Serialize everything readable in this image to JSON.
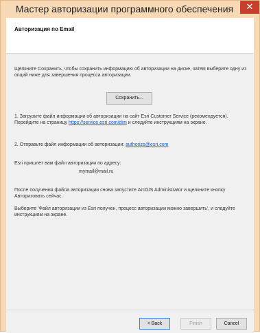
{
  "window": {
    "title": "Мастер авторизации программного обеспечения",
    "close_glyph": "✕"
  },
  "header": {
    "title": "Авторизация по Email"
  },
  "content": {
    "intro": "Щелкните Сохранить, чтобы сохранить информацию об авторизации на диске, затем выберите одну из опций ниже для завершения процесса авторизации.",
    "save_button": "Сохранить...",
    "step1_before": "1.  Загрузите файл информации об авторизации на сайт Esri Customer Service (рекомендуется). Перейдите  на страницу ",
    "step1_link": "https://service.esri.com/dim",
    "step1_after": " и следуйте инструкциям на экране.",
    "step2_before": "2.  Отправьте файл информации об авторизации: ",
    "step2_link": "authorize@esri.com",
    "esri_sends": "Esri пришлет вам файл авторизации по адресу:",
    "email": "mymail@mail.ru",
    "after_receive": "После получения файла авторизации снова запустите ArcGIS Administrator и щелкните кнопку Авторизовать сейчас.",
    "select_option": "Выберите 'Файл авторизации из Esri получен, процесс авторизации можно завершить', и следуйте инструкциям на экране."
  },
  "footer": {
    "back": "< Back",
    "finish": "Finish",
    "cancel": "Cancel"
  },
  "colors": {
    "titlebar": "#f7d9b6",
    "close": "#c7402f",
    "link": "#1a57c6"
  }
}
